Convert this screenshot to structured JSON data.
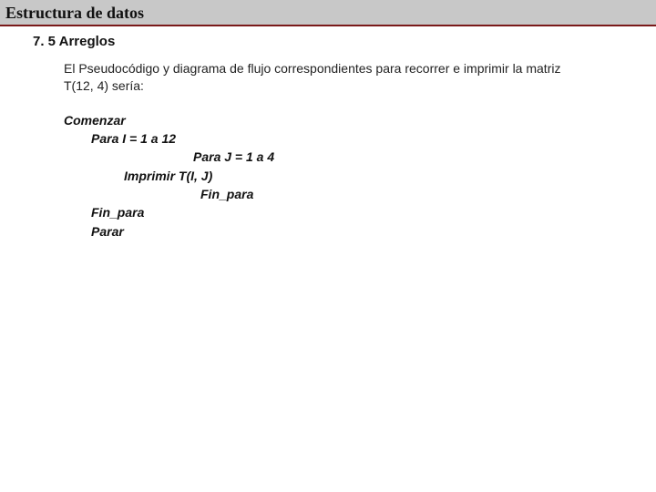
{
  "title": "Estructura de datos",
  "subtitle": "7. 5 Arreglos",
  "paragraph": "El Pseudocódigo y diagrama de flujo correspondientes para recorrer e imprimir la matriz T(12, 4) sería:",
  "pseudo": {
    "l1": "Comenzar",
    "l2": "Para I = 1 a 12",
    "l3": "Para J = 1 a 4",
    "l4": "Imprimir T(I, J)",
    "l5": "Fin_para",
    "l6": "Fin_para",
    "l7": "Parar"
  }
}
